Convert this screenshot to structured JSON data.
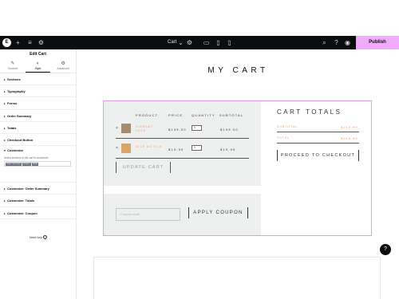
{
  "topbar": {
    "page_name": "Cart",
    "publish_label": "Publish",
    "icons": [
      "elementor-logo-icon",
      "add-icon",
      "structure-icon",
      "settings-icon",
      "chevron-down-icon",
      "page-settings-icon",
      "desktop-icon",
      "tablet-icon",
      "mobile-icon",
      "search-icon",
      "help-icon",
      "preview-icon"
    ]
  },
  "sidebar": {
    "title": "Edit Cart",
    "tabs": [
      {
        "label": "Content",
        "icon": "pencil-icon"
      },
      {
        "label": "Style",
        "icon": "half-circle-icon"
      },
      {
        "label": "Advanced",
        "icon": "gear-icon"
      }
    ],
    "sections": [
      "Sections",
      "Typography",
      "Forms",
      "Order Summary",
      "Totals",
      "Checkout Button"
    ],
    "customize": {
      "label": "Customize",
      "description": "Select sections of the cart to customize:",
      "tags": [
        "Order Summary",
        "Coupon",
        "Totals"
      ]
    },
    "sections_after": [
      "Customize: Order Summary",
      "Customize: Totals",
      "Customize: Coupon"
    ],
    "help": "Need help"
  },
  "page": {
    "title": "MY CART",
    "columns": [
      "PRODUCT",
      "PRICE",
      "QUANTITY",
      "SUBTOTAL"
    ],
    "items": [
      {
        "name": "VIBRANT VASE",
        "price": "$199.00",
        "qty": "1",
        "subtotal": "$199.00",
        "thumb_color": "#a78b6d"
      },
      {
        "name": "MILK BOTTLE",
        "price": "$19.99",
        "qty": "1",
        "subtotal": "$19.99",
        "thumb_color": "#d9a46a"
      }
    ],
    "remove_symbol": "×",
    "update_cart": "UPDATE CART",
    "coupon_placeholder": "Coupon code",
    "apply_coupon": "APPLY COUPON",
    "totals_title": "CART TOTALS",
    "subtotal_label": "SUBTOTAL",
    "subtotal_value": "$218.99",
    "total_label": "TOTAL",
    "total_value": "$218.99",
    "checkout_label": "PROCEED TO CHECKOUT"
  },
  "colors": {
    "accent": "#f0abfc",
    "product_text": "#e89a75",
    "panel_bg": "#eef0ef"
  }
}
